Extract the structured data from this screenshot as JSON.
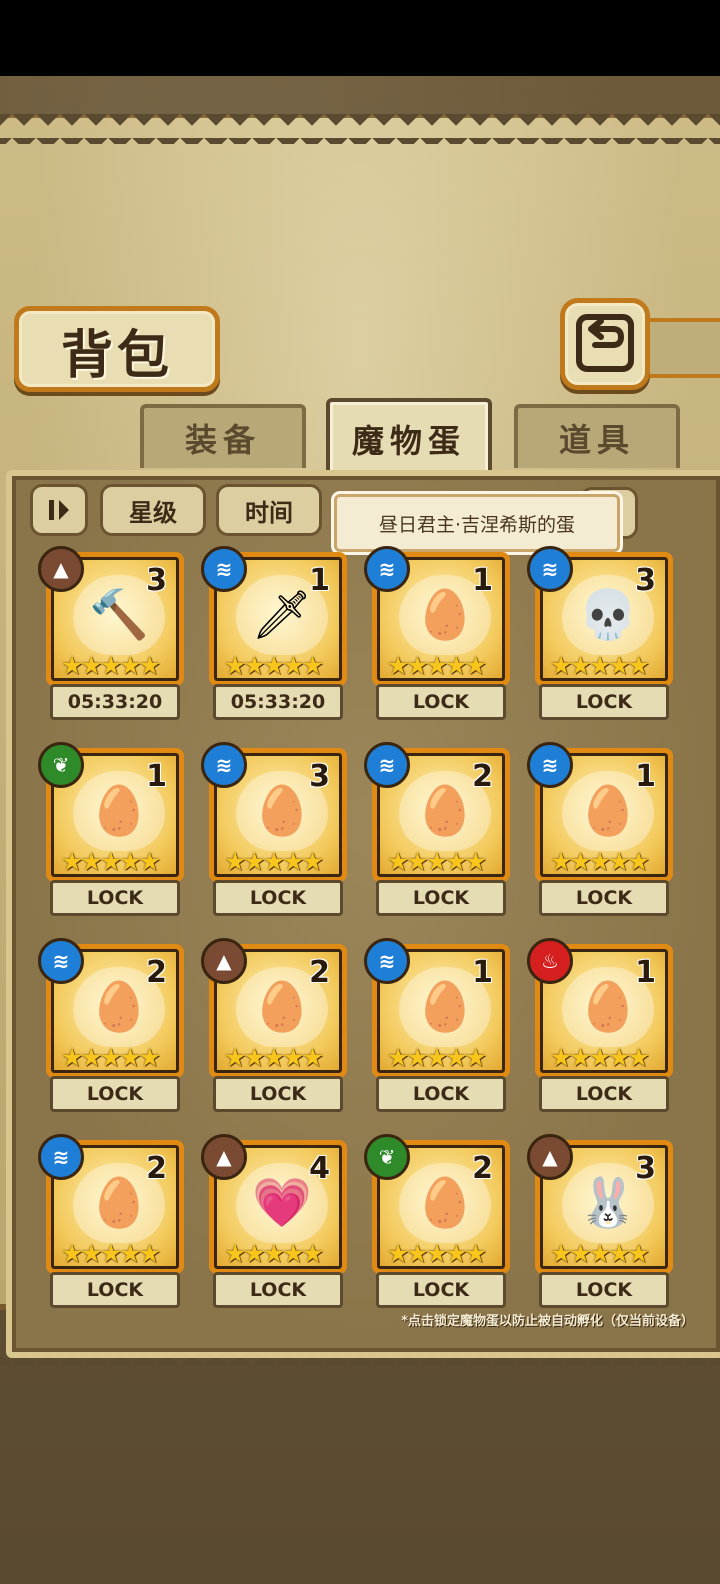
{
  "header": {
    "title": "背包"
  },
  "tabs": [
    {
      "label": "装备",
      "active": false
    },
    {
      "label": "魔物蛋",
      "active": true
    },
    {
      "label": "道具",
      "active": false
    }
  ],
  "toolbar": {
    "filter_icon": "sort-toggle-icon",
    "sort_star_label": "星级",
    "sort_time_label": "时间"
  },
  "tooltip": {
    "text": "昼日君主·吉涅希斯的蛋"
  },
  "element_colors": {
    "earth": "#7a4a32",
    "water": "#1f7fd6",
    "nature": "#2f8a2a",
    "fire": "#d62020"
  },
  "items": [
    {
      "element": "earth",
      "count": "3",
      "status": "05:33:20",
      "icon": "hammer-icon",
      "stars": "★★★★★"
    },
    {
      "element": "water",
      "count": "1",
      "status": "05:33:20",
      "icon": "sword-icon",
      "stars": "★★★★★"
    },
    {
      "element": "water",
      "count": "1",
      "status": "LOCK",
      "icon": "crowned-egg-icon",
      "stars": "★★★★★"
    },
    {
      "element": "water",
      "count": "3",
      "status": "LOCK",
      "icon": "skull-egg-icon",
      "stars": "★★★★★"
    },
    {
      "element": "nature",
      "count": "1",
      "status": "LOCK",
      "icon": "wreath-egg-icon",
      "stars": "★★★★★"
    },
    {
      "element": "water",
      "count": "3",
      "status": "LOCK",
      "icon": "tentacle-egg-icon",
      "stars": "★★★★★"
    },
    {
      "element": "water",
      "count": "2",
      "status": "LOCK",
      "icon": "blade-egg-icon",
      "stars": "★★★★★"
    },
    {
      "element": "water",
      "count": "1",
      "status": "LOCK",
      "icon": "ribbon-egg-icon",
      "stars": "★★★★★"
    },
    {
      "element": "water",
      "count": "2",
      "status": "LOCK",
      "icon": "heart-shield-egg-icon",
      "stars": "★★★★★"
    },
    {
      "element": "earth",
      "count": "2",
      "status": "LOCK",
      "icon": "beetle-egg-icon",
      "stars": "★★★★★"
    },
    {
      "element": "water",
      "count": "1",
      "status": "LOCK",
      "icon": "angel-egg-icon",
      "stars": "★★★★★"
    },
    {
      "element": "fire",
      "count": "1",
      "status": "LOCK",
      "icon": "horned-egg-icon",
      "stars": "★★★★★"
    },
    {
      "element": "water",
      "count": "2",
      "status": "LOCK",
      "icon": "shell-egg-icon",
      "stars": "★★★★★"
    },
    {
      "element": "earth",
      "count": "4",
      "status": "LOCK",
      "icon": "heart-egg-icon",
      "stars": "★★★★★"
    },
    {
      "element": "nature",
      "count": "2",
      "status": "LOCK",
      "icon": "spotted-egg-icon",
      "stars": "★★★★★"
    },
    {
      "element": "earth",
      "count": "3",
      "status": "LOCK",
      "icon": "bunny-egg-icon",
      "stars": "★★★★★"
    }
  ],
  "footer": {
    "note": "*点击锁定魔物蛋以防止被自动孵化（仅当前设备）"
  }
}
